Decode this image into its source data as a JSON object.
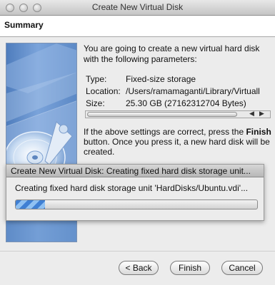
{
  "window": {
    "title": "Create New Virtual Disk"
  },
  "header": {
    "heading": "Summary"
  },
  "intro": "You are going to create a new virtual hard disk with the following parameters:",
  "parameters": [
    {
      "label": "Type:",
      "value": "Fixed-size storage"
    },
    {
      "label": "Location:",
      "value": "/Users/ramamaganti/Library/Virtuall"
    },
    {
      "label": "Size:",
      "value": "25.30 GB (27162312704 Bytes)"
    }
  ],
  "confirm": {
    "before": "If the above settings are correct, press the ",
    "bold": "Finish",
    "after": " button. Once you press it, a new hard disk will be created."
  },
  "progress_dialog": {
    "title": "Create New Virtual Disk: Creating fixed hard disk storage unit...",
    "message": "Creating fixed hard disk storage unit 'HardDisks/Ubuntu.vdi'...",
    "progress_fraction": 0.12,
    "bar_color": "#3f7fd3"
  },
  "buttons": {
    "back": "< Back",
    "finish": "Finish",
    "cancel": "Cancel"
  },
  "icons": [
    "hard-disk-icon",
    "scroll-left-arrow-icon",
    "scroll-right-arrow-icon"
  ]
}
